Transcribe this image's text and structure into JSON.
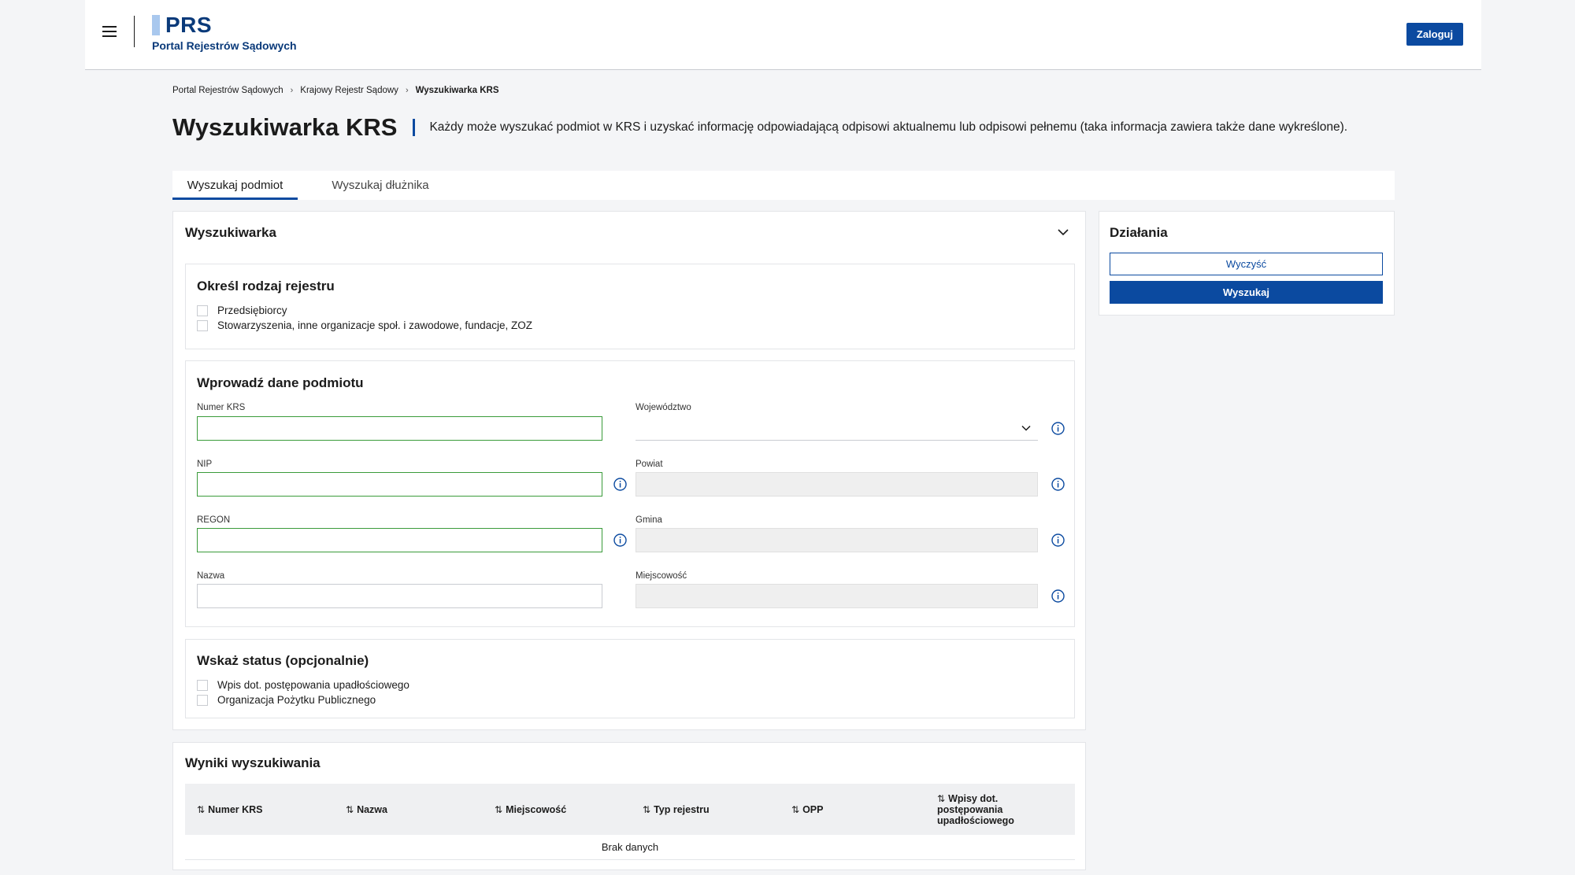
{
  "header": {
    "logo_text": "PRS",
    "logo_subtitle": "Portal Rejestrów Sądowych",
    "login_label": "Zaloguj"
  },
  "breadcrumb": {
    "items": [
      "Portal Rejestrów Sądowych",
      "Krajowy Rejestr Sądowy"
    ],
    "current": "Wyszukiwarka KRS"
  },
  "page": {
    "title": "Wyszukiwarka KRS",
    "description": "Każdy może wyszukać podmiot w KRS i uzyskać informację odpowiadającą odpisowi aktualnemu lub odpisowi pełnemu (taka informacja zawiera także dane wykreślone)."
  },
  "tabs": [
    {
      "label": "Wyszukaj podmiot",
      "active": true
    },
    {
      "label": "Wyszukaj dłużnika",
      "active": false
    }
  ],
  "search": {
    "title": "Wyszukiwarka",
    "register": {
      "title": "Określ rodzaj rejestru",
      "options": [
        "Przedsiębiorcy",
        "Stowarzyszenia, inne organizacje społ. i zawodowe, fundacje, ZOZ"
      ]
    },
    "entity": {
      "title": "Wprowadź dane podmiotu",
      "krs_label": "Numer KRS",
      "krs_value": "",
      "nip_label": "NIP",
      "nip_value": "",
      "regon_label": "REGON",
      "regon_value": "",
      "name_label": "Nazwa",
      "name_value": "",
      "voivodeship_label": "Województwo",
      "voivodeship_value": "",
      "county_label": "Powiat",
      "municipality_label": "Gmina",
      "locality_label": "Miejscowość"
    },
    "status": {
      "title": "Wskaż status (opcjonalnie)",
      "options": [
        "Wpis dot. postępowania upadłościowego",
        "Organizacja Pożytku Publicznego"
      ]
    }
  },
  "actions": {
    "title": "Działania",
    "clear_label": "Wyczyść",
    "search_label": "Wyszukaj"
  },
  "results": {
    "title": "Wyniki wyszukiwania",
    "columns": [
      "Numer KRS",
      "Nazwa",
      "Miejscowość",
      "Typ rejestru",
      "OPP",
      "Wpisy dot. postępowania upadłościowego"
    ],
    "empty_text": "Brak danych",
    "sort_icon": "sort-arrows-icon"
  },
  "colors": {
    "primary": "#0b4aa0",
    "valid_border": "#3a9b3a",
    "disabled_bg": "#efefef"
  }
}
